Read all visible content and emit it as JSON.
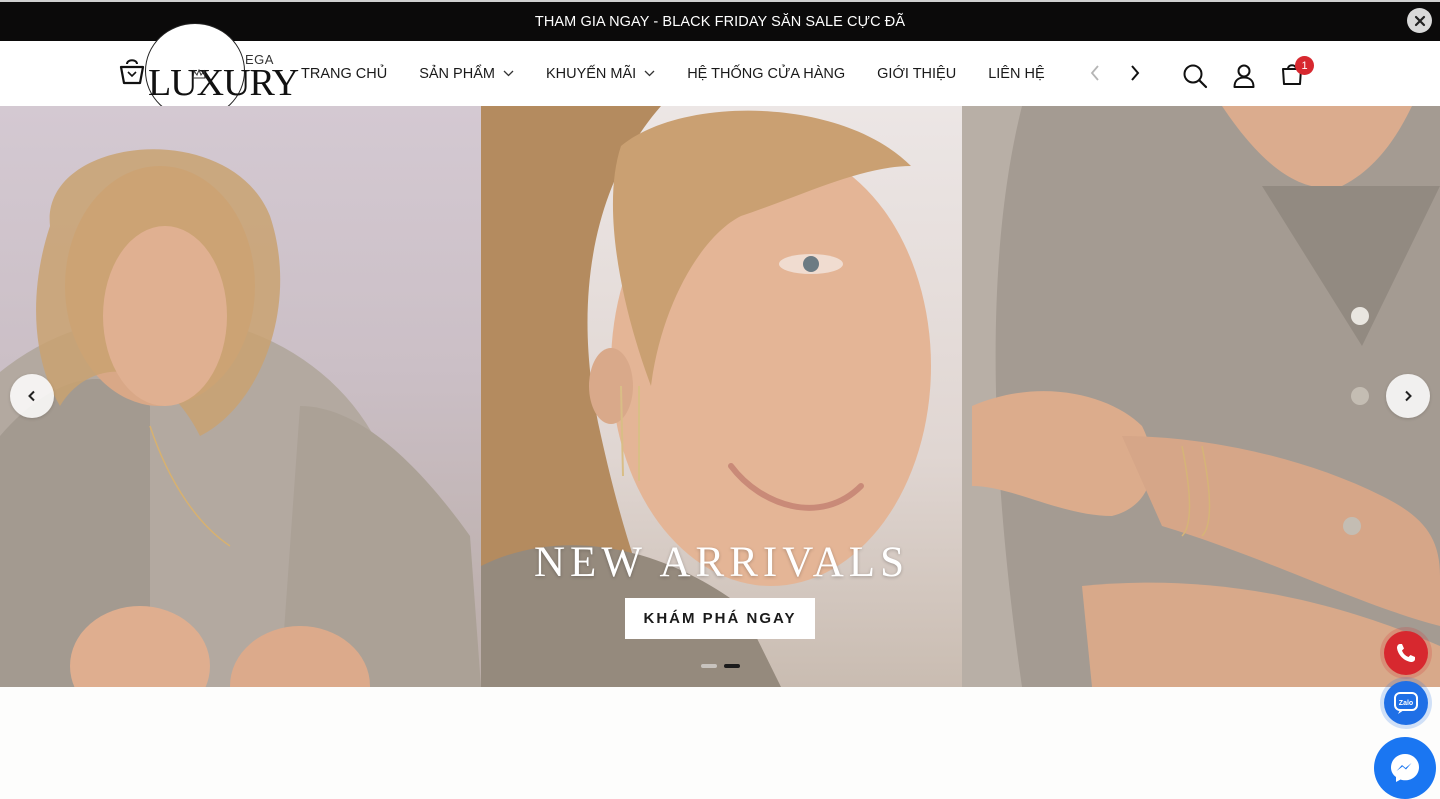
{
  "promo": {
    "text": "THAM GIA NGAY - BLACK FRIDAY SĂN SALE CỰC ĐÃ"
  },
  "logo": {
    "text": "LUXURY",
    "suffix": "EGA"
  },
  "nav": {
    "items": [
      {
        "label": "TRANG CHỦ",
        "has_dropdown": false
      },
      {
        "label": "SẢN PHẨM",
        "has_dropdown": true
      },
      {
        "label": "KHUYẾN MÃI",
        "has_dropdown": true
      },
      {
        "label": "HỆ THỐNG CỬA HÀNG",
        "has_dropdown": false
      },
      {
        "label": "GIỚI THIỆU",
        "has_dropdown": false
      },
      {
        "label": "LIÊN HỆ",
        "has_dropdown": false
      }
    ]
  },
  "header_icons": [
    "search-icon",
    "user-icon",
    "cart-icon"
  ],
  "cart": {
    "count": "1"
  },
  "hero": {
    "title": "NEW ARRIVALS",
    "cta_label": "KHÁM PHÁ NGAY",
    "slides_total": 2,
    "active_slide": 2
  },
  "contacts": [
    "phone-icon",
    "zalo-icon",
    "messenger-icon"
  ],
  "colors": {
    "promo_bg": "#0b0a0a",
    "badge": "#d7282f",
    "phone": "#d7282f",
    "zalo": "#1f6fe6",
    "messenger": "#1a76f2"
  }
}
